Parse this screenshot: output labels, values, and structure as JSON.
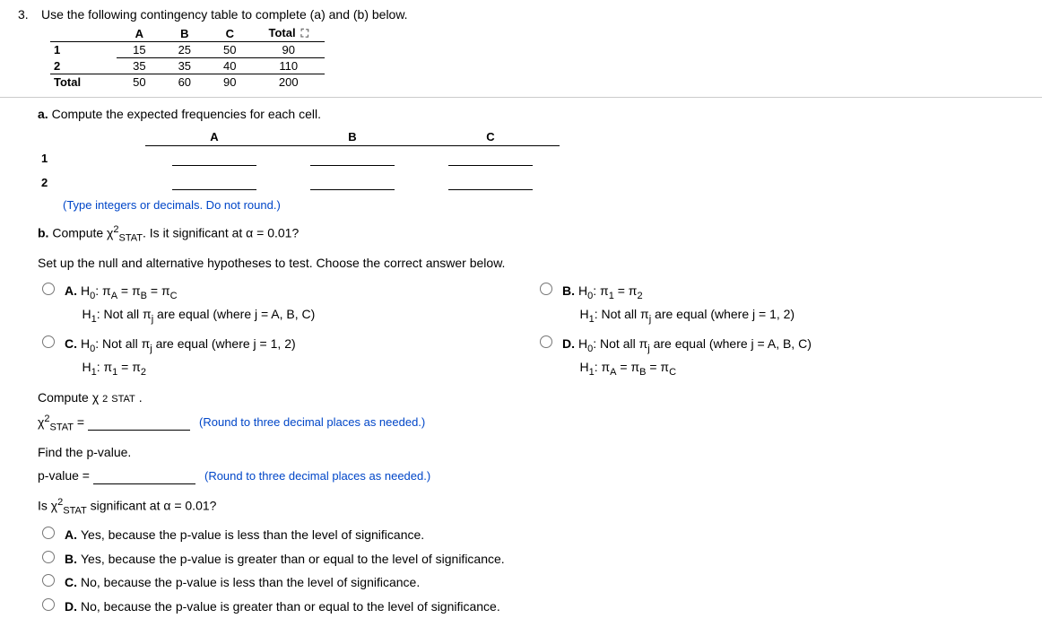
{
  "question_number": "3.",
  "question_text": "Use the following contingency table to complete (a) and (b) below.",
  "contingency": {
    "col_headers": [
      "A",
      "B",
      "C",
      "Total"
    ],
    "rows": [
      {
        "label": "1",
        "cells": [
          "15",
          "25",
          "50",
          "90"
        ]
      },
      {
        "label": "2",
        "cells": [
          "35",
          "35",
          "40",
          "110"
        ]
      },
      {
        "label": "Total",
        "cells": [
          "50",
          "60",
          "90",
          "200"
        ]
      }
    ]
  },
  "part_a": {
    "label": "a.",
    "text": "Compute the expected frequencies for each cell.",
    "col_headers": [
      "A",
      "B",
      "C"
    ],
    "row_labels": [
      "1",
      "2"
    ],
    "hint": "(Type integers or decimals. Do not round.)"
  },
  "part_b": {
    "label": "b.",
    "text_prefix": "Compute ",
    "chi_html": "χ²STAT",
    "text_suffix": ". Is it significant at α = 0.01?",
    "setup_text": "Set up the null and alternative hypotheses to test. Choose the correct answer below.",
    "options": {
      "A": {
        "h0": "H₀: πA = πB = πC",
        "h1": "H₁: Not all πⱼ are equal (where j = A, B, C)"
      },
      "B": {
        "h0": "H₀: π₁ = π₂",
        "h1": "H₁: Not all πⱼ are equal (where j = 1, 2)"
      },
      "C": {
        "h0": "H₀: Not all πⱼ are equal (where j = 1, 2)",
        "h1": "H₁: π₁ = π₂"
      },
      "D": {
        "h0": "H₀: Not all πⱼ are equal (where j = A, B, C)",
        "h1": "H₁: πA = πB = πC"
      }
    },
    "compute_label_prefix": "Compute ",
    "compute_label_suffix": " .",
    "chi_eq_prefix": "χ²STAT =",
    "round_hint": "(Round to three decimal places as needed.)",
    "find_pvalue": "Find the p-value.",
    "pvalue_label": "p-value =",
    "signif_question_prefix": "Is ",
    "signif_question_suffix": " significant at α = 0.01?",
    "signif_options": {
      "A": "Yes, because the p-value is less than the level of significance.",
      "B": "Yes, because the p-value is greater than or equal to the level of significance.",
      "C": "No, because the p-value is less than the level of significance.",
      "D": "No, because the p-value is greater than or equal to the level of significance."
    }
  },
  "letters": {
    "A": "A.",
    "B": "B.",
    "C": "C.",
    "D": "D."
  }
}
